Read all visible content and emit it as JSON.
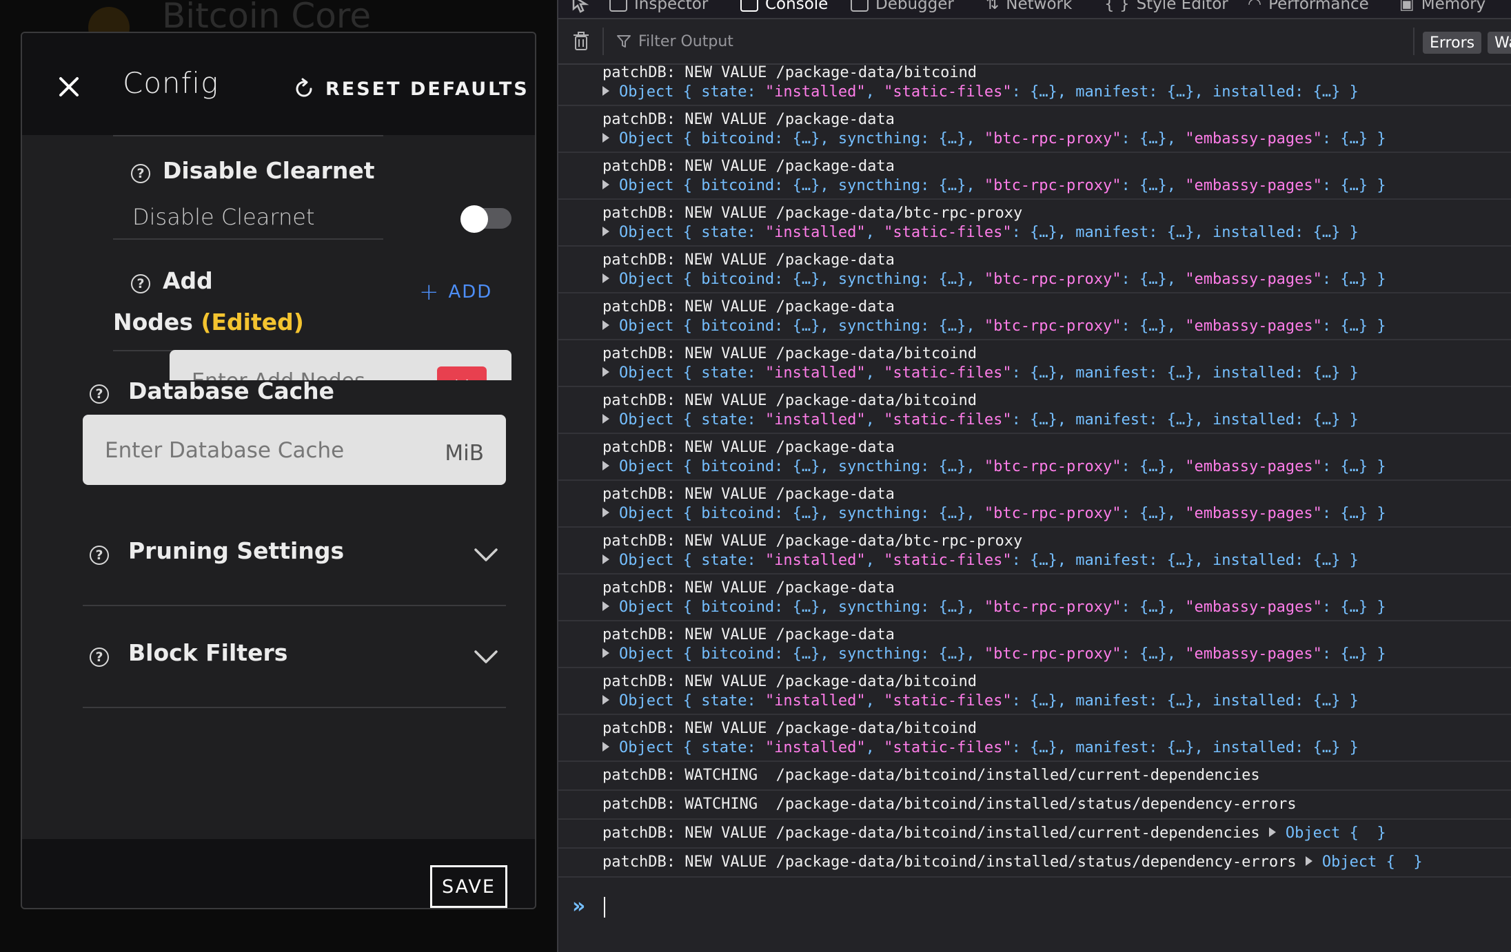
{
  "app": {
    "title": "Bitcoin Core"
  },
  "modal": {
    "title": "Config",
    "reset_label": "RESET DEFAULTS",
    "save_label": "SAVE",
    "sections": {
      "disable_clearnet": {
        "title": "Disable Clearnet",
        "toggle_label": "Disable Clearnet",
        "toggle_on": false
      },
      "add_nodes": {
        "title_line1": "Add",
        "title_line2": "Nodes",
        "edited": "(Edited)",
        "add_label": "ADD",
        "input_placeholder": "Enter Add Nodes"
      },
      "database_cache": {
        "title": "Database Cache",
        "placeholder": "Enter Database Cache",
        "unit": "MiB"
      },
      "pruning": {
        "title": "Pruning Settings"
      },
      "block_filters": {
        "title": "Block Filters"
      }
    }
  },
  "devtools": {
    "tabs": [
      {
        "label": "Inspector",
        "active": false
      },
      {
        "label": "Console",
        "active": true
      },
      {
        "label": "Debugger",
        "active": false
      },
      {
        "label": "Network",
        "active": false
      },
      {
        "label": "Style Editor",
        "active": false
      },
      {
        "label": "Performance",
        "active": false
      },
      {
        "label": "Memory",
        "active": false
      }
    ],
    "filter_placeholder": "Filter Output",
    "pills": [
      "Errors",
      "Wa"
    ],
    "console": [
      {
        "msg": "patchDB: NEW VALUE /package-data/bitcoind",
        "obj": "bitcoind-obj"
      },
      {
        "msg": "patchDB: NEW VALUE /package-data",
        "obj": "pkg-obj"
      },
      {
        "msg": "patchDB: NEW VALUE /package-data",
        "obj": "pkg-obj"
      },
      {
        "msg": "patchDB: NEW VALUE /package-data/btc-rpc-proxy",
        "obj": "bitcoind-obj"
      },
      {
        "msg": "patchDB: NEW VALUE /package-data",
        "obj": "pkg-obj"
      },
      {
        "msg": "patchDB: NEW VALUE /package-data",
        "obj": "pkg-obj"
      },
      {
        "msg": "patchDB: NEW VALUE /package-data/bitcoind",
        "obj": "bitcoind-obj"
      },
      {
        "msg": "patchDB: NEW VALUE /package-data/bitcoind",
        "obj": "bitcoind-obj"
      },
      {
        "msg": "patchDB: NEW VALUE /package-data",
        "obj": "pkg-obj"
      },
      {
        "msg": "patchDB: NEW VALUE /package-data",
        "obj": "pkg-obj"
      },
      {
        "msg": "patchDB: NEW VALUE /package-data/btc-rpc-proxy",
        "obj": "bitcoind-obj"
      },
      {
        "msg": "patchDB: NEW VALUE /package-data",
        "obj": "pkg-obj"
      },
      {
        "msg": "patchDB: NEW VALUE /package-data",
        "obj": "pkg-obj"
      },
      {
        "msg": "patchDB: NEW VALUE /package-data/bitcoind",
        "obj": "bitcoind-obj"
      },
      {
        "msg": "patchDB: NEW VALUE /package-data/bitcoind",
        "obj": "bitcoind-obj"
      },
      {
        "msg": "patchDB: WATCHING  /package-data/bitcoind/installed/current-dependencies",
        "obj": null
      },
      {
        "msg": "patchDB: WATCHING  /package-data/bitcoind/installed/status/dependency-errors",
        "obj": null
      },
      {
        "msg": "patchDB: NEW VALUE /package-data/bitcoind/installed/current-dependencies",
        "obj": "empty-obj"
      },
      {
        "msg": "patchDB: NEW VALUE /package-data/bitcoind/installed/status/dependency-errors",
        "obj": "empty-obj"
      }
    ],
    "objects": {
      "bitcoind-obj": [
        [
          "p",
          "Object { "
        ],
        [
          "k",
          "state: "
        ],
        [
          "s",
          "\"installed\""
        ],
        [
          "p",
          ", "
        ],
        [
          "s",
          "\"static-files\""
        ],
        [
          "k",
          ": {…}, manifest: {…}, installed: {…} }"
        ]
      ],
      "pkg-obj": [
        [
          "p",
          "Object { "
        ],
        [
          "k",
          "bitcoind: {…}, syncthing: {…}, "
        ],
        [
          "s",
          "\"btc-rpc-proxy\""
        ],
        [
          "k",
          ": {…}, "
        ],
        [
          "s",
          "\"embassy-pages\""
        ],
        [
          "k",
          ": {…} }"
        ]
      ],
      "empty-obj": [
        [
          "p",
          "Object {  }"
        ]
      ]
    },
    "colors": {
      "object": "#75bfff",
      "string": "#ff7de9"
    }
  }
}
